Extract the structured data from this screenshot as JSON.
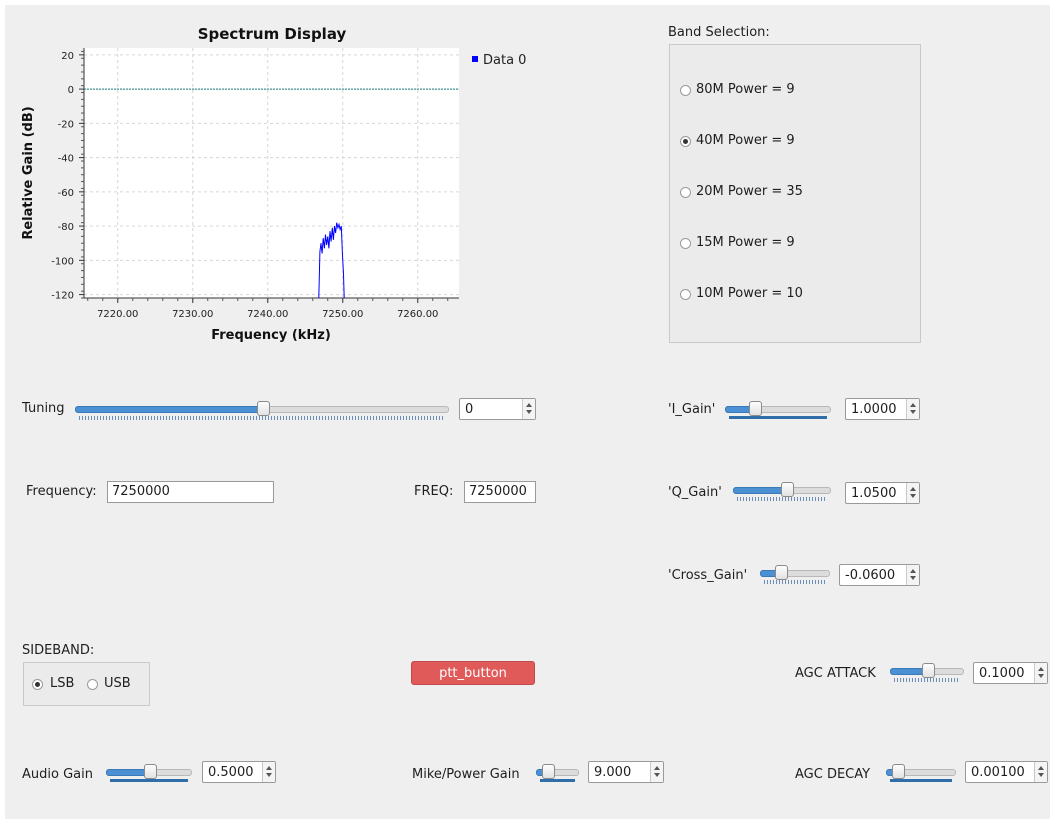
{
  "chart_data": {
    "type": "line",
    "title": "Spectrum Display",
    "xlabel": "Frequency (kHz)",
    "ylabel": "Relative Gain (dB)",
    "xlim": [
      7215.5,
      7265.5
    ],
    "ylim": [
      -122,
      24
    ],
    "x_ticks": [
      7220,
      7230,
      7240,
      7250,
      7260
    ],
    "x_tick_labels": [
      "7220.00",
      "7230.00",
      "7240.00",
      "7250.00",
      "7260.00"
    ],
    "y_ticks": [
      20,
      0,
      -20,
      -40,
      -60,
      -80,
      -100,
      -120
    ],
    "y_tick_labels": [
      "20",
      "0",
      "-20",
      "-40",
      "-60",
      "-80",
      "-100",
      "-120"
    ],
    "grid": true,
    "legend_position": "right",
    "series": [
      {
        "name": "Data 0",
        "color": "#0000ff",
        "x": [
          7246.8,
          7246.95,
          7247.1,
          7247.25,
          7247.4,
          7247.55,
          7247.7,
          7247.85,
          7248.0,
          7248.15,
          7248.3,
          7248.45,
          7248.6,
          7248.75,
          7248.9,
          7249.05,
          7249.2,
          7249.35,
          7249.5,
          7249.65,
          7249.8,
          7249.95,
          7250.1,
          7250.2
        ],
        "y": [
          -122,
          -95,
          -90,
          -96,
          -87,
          -93,
          -85,
          -91,
          -86,
          -93,
          -83,
          -89,
          -81,
          -88,
          -80,
          -84,
          -78,
          -81,
          -79,
          -82,
          -80,
          -96,
          -108,
          -122
        ]
      }
    ],
    "baseline": {
      "y": 0,
      "color": "#1a7f7f"
    }
  },
  "band": {
    "title": "Band Selection:",
    "options": [
      {
        "label": "80M Power = 9",
        "selected": false
      },
      {
        "label": "40M Power = 9",
        "selected": true
      },
      {
        "label": "20M Power = 35",
        "selected": false
      },
      {
        "label": "15M Power = 9",
        "selected": false
      },
      {
        "label": "10M Power = 10",
        "selected": false
      }
    ]
  },
  "tuning": {
    "label": "Tuning",
    "value": "0",
    "level": 0.5
  },
  "i_gain": {
    "label": "'I_Gain'",
    "value": "1.0000",
    "level": 0.25
  },
  "q_gain": {
    "label": "'Q_Gain'",
    "value": "1.0500",
    "level": 0.55
  },
  "cross_gain": {
    "label": "'Cross_Gain'",
    "value": "-0.0600",
    "level": 0.25
  },
  "frequency": {
    "label": "Frequency:",
    "value": "7250000"
  },
  "freq": {
    "label": "FREQ:",
    "value": "7250000"
  },
  "sideband": {
    "title": "SIDEBAND:",
    "lsb": "LSB",
    "usb": "USB",
    "selected": "LSB"
  },
  "ptt": {
    "label": "ptt_button",
    "color": "#e05a5a"
  },
  "agc_attack": {
    "label": "AGC ATTACK",
    "value": "0.1000",
    "level": 0.5
  },
  "audio_gain": {
    "label": "Audio Gain",
    "value": "0.5000",
    "level": 0.5
  },
  "mike_gain": {
    "label": "Mike/Power Gain",
    "value": "9.000",
    "level": 0.2
  },
  "agc_decay": {
    "label": "AGC DECAY",
    "value": "0.00100",
    "level": 0.1
  }
}
